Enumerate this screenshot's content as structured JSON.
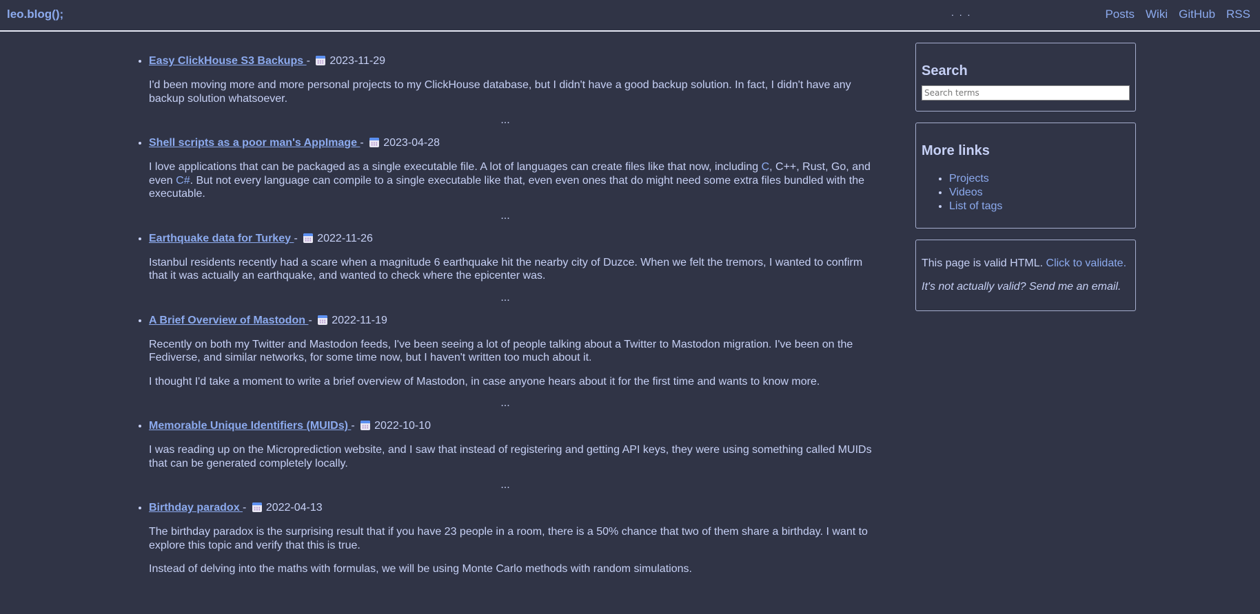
{
  "header": {
    "brand": "leo.blog();",
    "dots": ". . .",
    "nav": [
      {
        "label": "Posts"
      },
      {
        "label": "Wiki"
      },
      {
        "label": "GitHub"
      },
      {
        "label": "RSS"
      }
    ]
  },
  "posts": [
    {
      "title": "Easy ClickHouse S3 Backups ",
      "separator": " - ",
      "date": "2023-11-29",
      "paragraphs": [
        "I'd been moving more and more personal projects to my ClickHouse database, but I didn't have a good backup solution. In fact, I didn't have any backup solution whatsoever."
      ],
      "more": "..."
    },
    {
      "title": "Shell scripts as a poor man's AppImage ",
      "separator": " - ",
      "date": "2023-04-28",
      "paragraph_parts": {
        "p1": "I love applications that can be packaged as a single executable file. A lot of languages can create files like that now, including ",
        "link1": "C",
        "p2": ", C++, Rust, Go, and even ",
        "link2": "C#",
        "p3": ". But not every language can compile to a single executable like that, even even ones that do might need some extra files bundled with the executable."
      },
      "more": "..."
    },
    {
      "title": "Earthquake data for Turkey ",
      "separator": " - ",
      "date": "2022-11-26",
      "paragraphs": [
        "Istanbul residents recently had a scare when a magnitude 6 earthquake hit the nearby city of Duzce. When we felt the tremors, I wanted to confirm that it was actually an earthquake, and wanted to check where the epicenter was."
      ],
      "more": "..."
    },
    {
      "title": "A Brief Overview of Mastodon ",
      "separator": " - ",
      "date": "2022-11-19",
      "paragraphs": [
        "Recently on both my Twitter and Mastodon feeds, I've been seeing a lot of people talking about a Twitter to Mastodon migration. I've been on the Fediverse, and similar networks, for some time now, but I haven't written too much about it.",
        "I thought I'd take a moment to write a brief overview of Mastodon, in case anyone hears about it for the first time and wants to know more."
      ],
      "more": "..."
    },
    {
      "title": "Memorable Unique Identifiers (MUIDs) ",
      "separator": " - ",
      "date": "2022-10-10",
      "paragraphs": [
        "I was reading up on the Microprediction website, and I saw that instead of registering and getting API keys, they were using something called MUIDs that can be generated completely locally."
      ],
      "more": "..."
    },
    {
      "title": "Birthday paradox ",
      "separator": " - ",
      "date": "2022-04-13",
      "paragraphs": [
        "The birthday paradox is the surprising result that if you have 23 people in a room, there is a 50% chance that two of them share a birthday. I want to explore this topic and verify that this is true.",
        "Instead of delving into the maths with formulas, we will be using Monte Carlo methods with random simulations."
      ]
    }
  ],
  "sidebar": {
    "search": {
      "heading": "Search",
      "placeholder": "Search terms",
      "value": ""
    },
    "links": {
      "heading": "More links",
      "items": [
        {
          "label": "Projects"
        },
        {
          "label": "Videos"
        },
        {
          "label": "List of tags"
        }
      ]
    },
    "validation": {
      "text": "This page is valid HTML. ",
      "link": "Click to validate.",
      "note": "It's not actually valid? Send me an email."
    }
  },
  "icons": {
    "date": "calendar-icon"
  }
}
